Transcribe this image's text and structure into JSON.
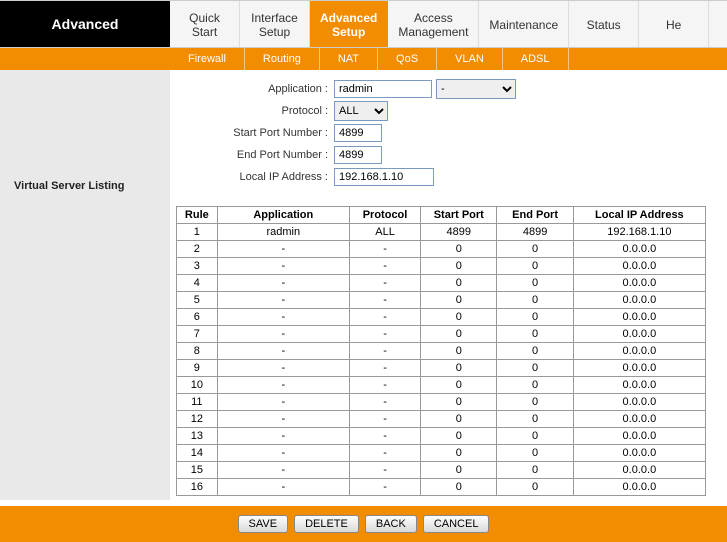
{
  "brand": "Advanced",
  "mainTabs": [
    {
      "line1": "Quick",
      "line2": "Start",
      "active": false
    },
    {
      "line1": "Interface",
      "line2": "Setup",
      "active": false
    },
    {
      "line1": "Advanced",
      "line2": "Setup",
      "active": true
    },
    {
      "line1": "Access",
      "line2": "Management",
      "active": false
    },
    {
      "line1": "Maintenance",
      "line2": "",
      "active": false
    },
    {
      "line1": "Status",
      "line2": "",
      "active": false
    },
    {
      "line1": "He",
      "line2": "",
      "active": false
    }
  ],
  "subTabs": [
    "Firewall",
    "Routing",
    "NAT",
    "QoS",
    "VLAN",
    "ADSL"
  ],
  "sidebar": {
    "section": "Virtual Server Listing"
  },
  "form": {
    "labels": {
      "application": "Application :",
      "protocol": "Protocol :",
      "startPort": "Start Port Number :",
      "endPort": "End Port Number :",
      "localIp": "Local IP Address :"
    },
    "values": {
      "application": "radmin",
      "appSelect": "-",
      "protocol": "ALL",
      "startPort": "4899",
      "endPort": "4899",
      "localIp": "192.168.1.10"
    }
  },
  "table": {
    "headers": [
      "Rule",
      "Application",
      "Protocol",
      "Start Port",
      "End Port",
      "Local IP Address"
    ],
    "rows": [
      {
        "rule": "1",
        "app": "radmin",
        "proto": "ALL",
        "start": "4899",
        "end": "4899",
        "ip": "192.168.1.10"
      },
      {
        "rule": "2",
        "app": "-",
        "proto": "-",
        "start": "0",
        "end": "0",
        "ip": "0.0.0.0"
      },
      {
        "rule": "3",
        "app": "-",
        "proto": "-",
        "start": "0",
        "end": "0",
        "ip": "0.0.0.0"
      },
      {
        "rule": "4",
        "app": "-",
        "proto": "-",
        "start": "0",
        "end": "0",
        "ip": "0.0.0.0"
      },
      {
        "rule": "5",
        "app": "-",
        "proto": "-",
        "start": "0",
        "end": "0",
        "ip": "0.0.0.0"
      },
      {
        "rule": "6",
        "app": "-",
        "proto": "-",
        "start": "0",
        "end": "0",
        "ip": "0.0.0.0"
      },
      {
        "rule": "7",
        "app": "-",
        "proto": "-",
        "start": "0",
        "end": "0",
        "ip": "0.0.0.0"
      },
      {
        "rule": "8",
        "app": "-",
        "proto": "-",
        "start": "0",
        "end": "0",
        "ip": "0.0.0.0"
      },
      {
        "rule": "9",
        "app": "-",
        "proto": "-",
        "start": "0",
        "end": "0",
        "ip": "0.0.0.0"
      },
      {
        "rule": "10",
        "app": "-",
        "proto": "-",
        "start": "0",
        "end": "0",
        "ip": "0.0.0.0"
      },
      {
        "rule": "11",
        "app": "-",
        "proto": "-",
        "start": "0",
        "end": "0",
        "ip": "0.0.0.0"
      },
      {
        "rule": "12",
        "app": "-",
        "proto": "-",
        "start": "0",
        "end": "0",
        "ip": "0.0.0.0"
      },
      {
        "rule": "13",
        "app": "-",
        "proto": "-",
        "start": "0",
        "end": "0",
        "ip": "0.0.0.0"
      },
      {
        "rule": "14",
        "app": "-",
        "proto": "-",
        "start": "0",
        "end": "0",
        "ip": "0.0.0.0"
      },
      {
        "rule": "15",
        "app": "-",
        "proto": "-",
        "start": "0",
        "end": "0",
        "ip": "0.0.0.0"
      },
      {
        "rule": "16",
        "app": "-",
        "proto": "-",
        "start": "0",
        "end": "0",
        "ip": "0.0.0.0"
      }
    ]
  },
  "buttons": {
    "save": "SAVE",
    "delete": "DELETE",
    "back": "BACK",
    "cancel": "CANCEL"
  }
}
